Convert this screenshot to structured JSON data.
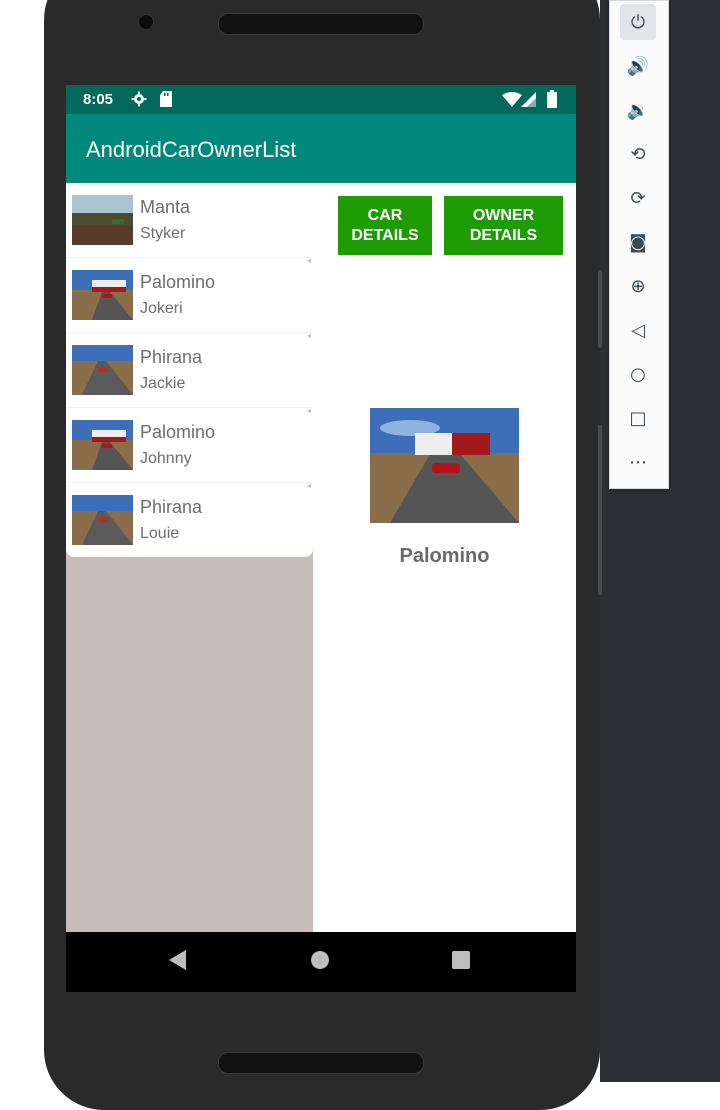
{
  "status_bar": {
    "time": "8:05"
  },
  "app_bar": {
    "title": "AndroidCarOwnerList"
  },
  "list": [
    {
      "car": "Manta",
      "owner": "Styker",
      "scene": "grass"
    },
    {
      "car": "Palomino",
      "owner": "Jokeri",
      "scene": "truck"
    },
    {
      "car": "Phirana",
      "owner": "Jackie",
      "scene": "road"
    },
    {
      "car": "Palomino",
      "owner": "Johnny",
      "scene": "truck"
    },
    {
      "car": "Phirana",
      "owner": "Louie",
      "scene": "road"
    }
  ],
  "buttons": {
    "car_details": "CAR DETAILS",
    "owner_details": "OWNER DETAILS"
  },
  "detail": {
    "car_name": "Palomino"
  },
  "emulator_toolbar": [
    "power-icon",
    "volume-up-icon",
    "volume-down-icon",
    "rotate-left-icon",
    "rotate-right-icon",
    "camera-icon",
    "zoom-icon",
    "back-icon",
    "home-icon",
    "overview-icon",
    "more-icon"
  ],
  "colors": {
    "status_bar": "#00695c",
    "app_bar": "#00897b",
    "button": "#1f9b06",
    "left_pane_bg": "#c8bdb9"
  }
}
